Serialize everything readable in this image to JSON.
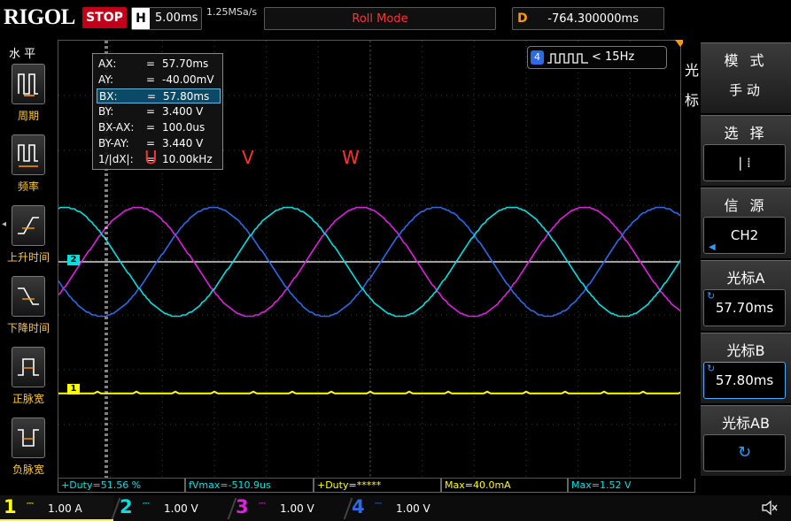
{
  "top_bar": {
    "logo": "RIGOL",
    "run_status": "STOP",
    "horizontal_letter": "H",
    "horizontal_scale": "5.00ms",
    "sample_rate": "1.25MSa/s",
    "mode": "Roll Mode",
    "delay_letter": "D",
    "delay_value": "-764.300000ms"
  },
  "left_menu": {
    "title": "水 平",
    "items": [
      {
        "label": "周期",
        "icon": "period-icon"
      },
      {
        "label": "频率",
        "icon": "frequency-icon"
      },
      {
        "label": "上升时间",
        "icon": "rise-time-icon"
      },
      {
        "label": "下降时间",
        "icon": "fall-time-icon"
      },
      {
        "label": "正脉宽",
        "icon": "positive-width-icon"
      },
      {
        "label": "负脉宽",
        "icon": "negative-width-icon"
      }
    ]
  },
  "cursor_readout": {
    "rows": [
      {
        "key": "AX:",
        "value": "57.70ms"
      },
      {
        "key": "AY:",
        "value": "-40.00mV"
      },
      {
        "key": "BX:",
        "value": "57.80ms"
      },
      {
        "key": "BY:",
        "value": "3.400 V"
      },
      {
        "key": "BX-AX:",
        "value": "100.0us"
      },
      {
        "key": "BY-AY:",
        "value": "3.440 V"
      },
      {
        "key": "1/|dX|:",
        "value": "10.00kHz"
      }
    ],
    "selected_index": 2,
    "eq": "="
  },
  "phase_labels": {
    "u": "U",
    "v": "V",
    "w": "W"
  },
  "trigger": {
    "source": "4",
    "frequency": "< 15Hz"
  },
  "right_menu": {
    "side_label_top": "光",
    "side_label_bottom": "标",
    "items": [
      {
        "title": "模 式",
        "value": "手 动"
      },
      {
        "title": "选 择",
        "value": "| ⁞"
      },
      {
        "title": "信 源",
        "value": "CH2"
      },
      {
        "title": "光标A",
        "value": "57.70ms"
      },
      {
        "title": "光标B",
        "value": "57.80ms"
      },
      {
        "title": "光标AB",
        "value": "↻"
      }
    ]
  },
  "measurements": [
    {
      "text": "+Duty=51.56 %",
      "color": "#00e0e0"
    },
    {
      "text": "fVmax=-510.9us",
      "color": "#00e0e0"
    },
    {
      "text": "+Duty=*****",
      "color": "#ffff00"
    },
    {
      "text": "Max=40.0mA",
      "color": "#ffff00"
    },
    {
      "text": "Max=1.52 V",
      "color": "#00e0e0"
    }
  ],
  "channels": [
    {
      "num": "1",
      "coupling": "⎓",
      "scale": "1.00 A",
      "color": "#ffff00",
      "active": true
    },
    {
      "num": "2",
      "coupling": "⎓",
      "scale": "1.00 V",
      "color": "#00e0e0",
      "active": false
    },
    {
      "num": "3",
      "coupling": "⎓",
      "scale": "1.00 V",
      "color": "#dd22dd",
      "active": false
    },
    {
      "num": "4",
      "coupling": "⎓",
      "scale": "1.00 V",
      "color": "#2d6ae6",
      "active": false
    }
  ],
  "channel_markers": {
    "ch1": "1",
    "ch2": "2"
  },
  "colors": {
    "ch1": "#ffff00",
    "ch2": "#00e0e0",
    "ch3": "#dd22dd",
    "ch4": "#2d6ae6",
    "accent_orange": "#ff9900",
    "stop_red": "#c0001a"
  },
  "chart_data": {
    "type": "line",
    "series": [
      {
        "channel": "ch3",
        "color": "#dd22dd",
        "amplitude_v": 1.6,
        "offset_v": 0.0,
        "period_div": 4.3,
        "phase_div": 0.45
      },
      {
        "channel": "ch4",
        "color": "#2d6ae6",
        "amplitude_v": 1.6,
        "offset_v": 0.0,
        "period_div": 4.3,
        "phase_div": 1.9
      },
      {
        "channel": "ch2",
        "color": "#00e0e0",
        "amplitude_v": 1.6,
        "offset_v": 0.0,
        "period_div": 4.3,
        "phase_div": 3.35
      },
      {
        "channel": "ch1",
        "color": "#ffff00",
        "amplitude_v": 0.0,
        "offset_v": -2.4,
        "period_div": 0,
        "phase_div": 0
      }
    ],
    "grid": true,
    "x_divisions": 12,
    "y_divisions": 8
  }
}
